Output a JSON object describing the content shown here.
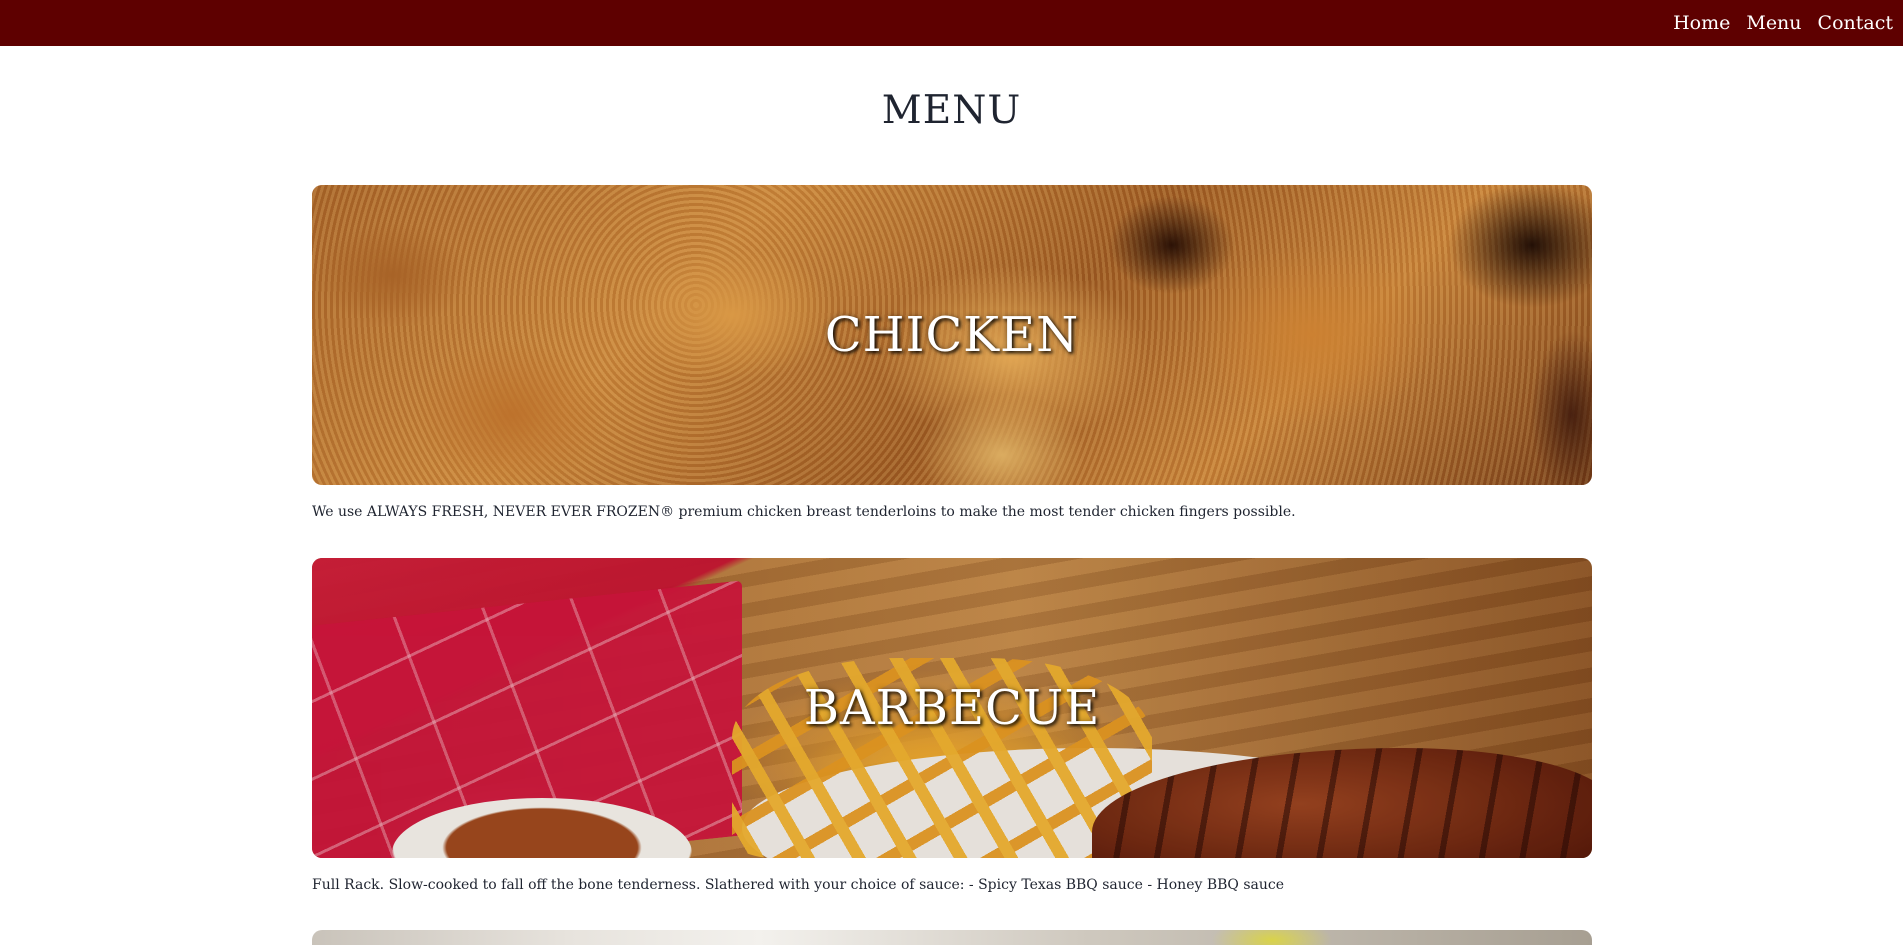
{
  "nav": {
    "links": [
      {
        "label": "Home"
      },
      {
        "label": "Menu"
      },
      {
        "label": "Contact"
      }
    ]
  },
  "page": {
    "title": "MENU"
  },
  "categories": [
    {
      "title": "CHICKEN",
      "description": "We use ALWAYS FRESH, NEVER EVER FROZEN® premium chicken breast tenderloins to make the most tender chicken fingers possible."
    },
    {
      "title": "BARBECUE",
      "description": "Full Rack. Slow-cooked to fall off the bone tenderness. Slathered with your choice of sauce: - Spicy Texas BBQ sauce - Honey BBQ sauce"
    }
  ],
  "colors": {
    "navbar": "#5e0000",
    "text": "#1f2430",
    "background": "#ffffff"
  }
}
